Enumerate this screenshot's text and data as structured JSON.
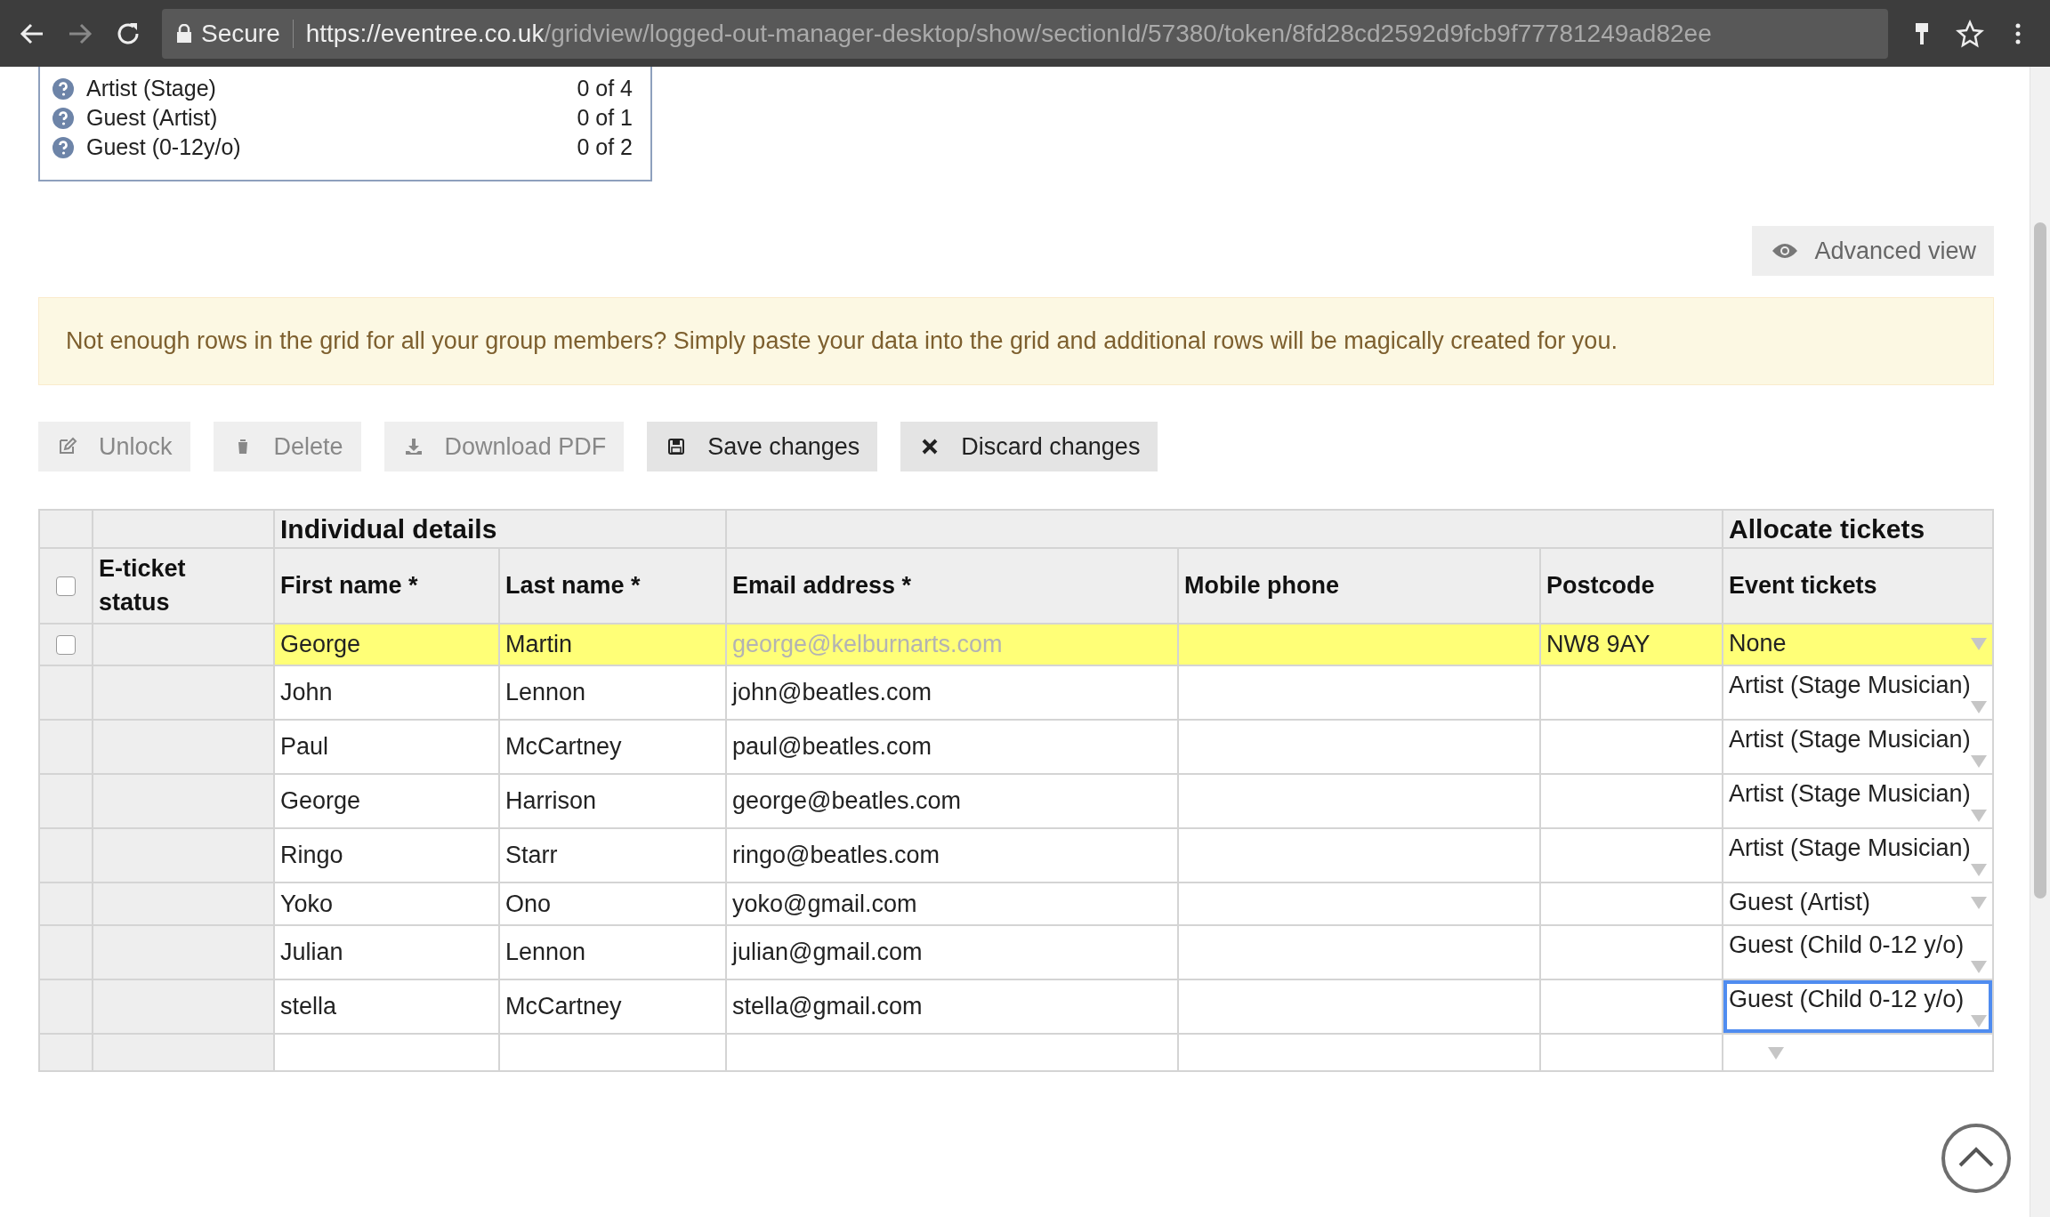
{
  "browser": {
    "secure_label": "Secure",
    "url_host": "https://eventree.co.uk",
    "url_path": "/gridview/logged-out-manager-desktop/show/sectionId/57380/token/8fd28cd2592d9fcb9f77781249ad82ee"
  },
  "allocation": [
    {
      "label": "Artist (Stage)",
      "count": "0 of 4"
    },
    {
      "label": "Guest (Artist)",
      "count": "0 of 1"
    },
    {
      "label": "Guest (0-12y/o)",
      "count": "0 of 2"
    }
  ],
  "advanced_view": "Advanced view",
  "notice": "Not enough rows in the grid for all your group members? Simply paste your data into the grid and additional rows will be magically created for you.",
  "toolbar": [
    {
      "kind": "unlock",
      "label": "Unlock",
      "disabled": true
    },
    {
      "kind": "delete",
      "label": "Delete",
      "disabled": true
    },
    {
      "kind": "download",
      "label": "Download PDF",
      "disabled": true
    },
    {
      "kind": "save",
      "label": "Save changes",
      "disabled": false
    },
    {
      "kind": "discard",
      "label": "Discard changes",
      "disabled": false
    }
  ],
  "table": {
    "groups": [
      "Individual details",
      "Allocate tickets"
    ],
    "columns": [
      "E-ticket status",
      "First name *",
      "Last name *",
      "Email address *",
      "Mobile phone",
      "Postcode",
      "Event tickets"
    ],
    "header_checked": false,
    "rows": [
      {
        "kind": "saved",
        "checked": false,
        "first": "George",
        "last": "Martin",
        "email": "george@kelburnarts.com",
        "postcode": "NW8 9AY",
        "ticket": "None",
        "focused": false
      },
      {
        "kind": "new",
        "first": "John",
        "last": "Lennon",
        "email": "john@beatles.com",
        "ticket": "Artist (Stage Musician)",
        "focused": false
      },
      {
        "kind": "new",
        "first": "Paul",
        "last": "McCartney",
        "email": "paul@beatles.com",
        "ticket": "Artist (Stage Musician)",
        "focused": false
      },
      {
        "kind": "new",
        "first": "George",
        "last": "Harrison",
        "email": "george@beatles.com",
        "ticket": "Artist (Stage Musician)",
        "focused": false
      },
      {
        "kind": "new",
        "first": "Ringo",
        "last": "Starr",
        "email": "ringo@beatles.com",
        "ticket": "Artist (Stage Musician)",
        "focused": false
      },
      {
        "kind": "new",
        "first": "Yoko",
        "last": "Ono",
        "email": "yoko@gmail.com",
        "ticket": "Guest (Artist)",
        "focused": false
      },
      {
        "kind": "new",
        "first": "Julian",
        "last": "Lennon",
        "email": "julian@gmail.com",
        "ticket": "Guest (Child 0-12 y/o)",
        "focused": false
      },
      {
        "kind": "new",
        "first": "stella",
        "last": "McCartney",
        "email": "stella@gmail.com",
        "ticket": "Guest (Child 0-12 y/o)",
        "focused": true
      }
    ]
  }
}
